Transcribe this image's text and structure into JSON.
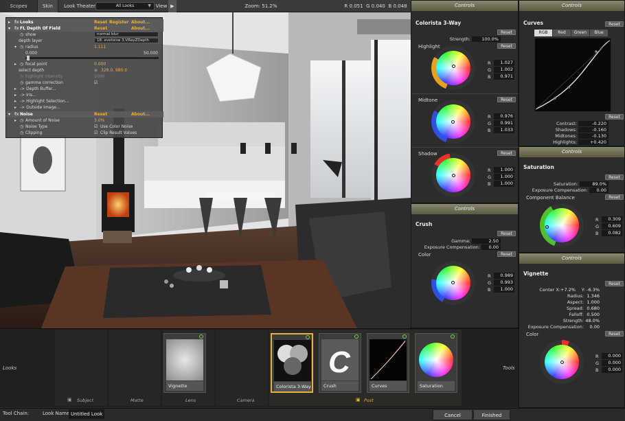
{
  "topbar": {
    "tab_scopes": "Scopes",
    "tab_skin": "Skin",
    "look_theater": "Look Theater",
    "looks_select": "All Looks",
    "view_label": "View",
    "zoom": "Zoom:  51.2%",
    "r": "R  0.051",
    "g": "G  0.040",
    "b": "B  0.048"
  },
  "looks_panel": {
    "looks": {
      "name": "Looks",
      "reset": "Reset",
      "register": "Register",
      "about": "About..."
    },
    "dof": {
      "name": "FL Depth Of Field",
      "reset": "Reset",
      "about": "About..."
    },
    "show_label": "show",
    "show_value": "normal blur",
    "depth_layer_label": "depth layer",
    "depth_layer_value": "18. evetoine 3.VRayZDepth",
    "radius_label": "radius",
    "radius_value": "1.111",
    "radius_min": "0.000",
    "radius_max": "50.000",
    "focal_label": "focal point",
    "focal_value": "0.000",
    "select_depth_label": "select depth",
    "select_depth_value": "328.0, 980.0",
    "highlight_intensity_label": "highlight intensity",
    "highlight_intensity_value": "1000",
    "gamma_label": "gamma correction",
    "depth_buffer": "-> Depth Buffer...",
    "iris": "-> Iris...",
    "highlight_selection": "-> Highlight Selection...",
    "outside_image": "-> Outside Image...",
    "noise": {
      "name": "Noise",
      "reset": "Reset",
      "about": "About..."
    },
    "amount_label": "Amount of Noise",
    "amount_value": "3.0%",
    "noise_type_label": "Noise Type",
    "use_color_noise": "Use Color Noise",
    "clipping_label": "Clipping",
    "clip_result": "Clip Result Values"
  },
  "colorista": {
    "header": "Controls",
    "title": "Colorista 3-Way",
    "reset": "Reset",
    "strength_label": "Strength:",
    "strength_value": "100.0%",
    "highlight": {
      "label": "Highlight",
      "reset": "Reset",
      "r": "1.027",
      "g": "1.002",
      "b": "0.971"
    },
    "midtone": {
      "label": "Midtone",
      "reset": "Reset",
      "r": "0.976",
      "g": "0.991",
      "b": "1.033"
    },
    "shadow": {
      "label": "Shadow",
      "reset": "Reset",
      "r": "1.000",
      "g": "1.000",
      "b": "1.000"
    }
  },
  "crush": {
    "header": "Controls",
    "title": "Crush",
    "reset": "Reset",
    "gamma_label": "Gamma:",
    "gamma_value": "2.50",
    "exposure_label": "Exposure Compensation:",
    "exposure_value": "0.00",
    "color": {
      "label": "Color",
      "reset": "Reset",
      "r": "0.989",
      "g": "0.993",
      "b": "1.000"
    }
  },
  "curves": {
    "header": "Controls",
    "title": "Curves",
    "reset": "Reset",
    "tabs": [
      "RGB",
      "Red",
      "Green",
      "Blue"
    ],
    "reset2": "Reset",
    "contrast_label": "Contrast:",
    "contrast_value": "-0.220",
    "shadows_label": "Shadows:",
    "shadows_value": "-0.160",
    "midtones_label": "Midtones:",
    "midtones_value": "-0.130",
    "highlights_label": "Highlights:",
    "highlights_value": "+0.420"
  },
  "saturation": {
    "header": "Controls",
    "title": "Saturation",
    "reset": "Reset",
    "sat_label": "Saturation:",
    "sat_value": "89.0%",
    "exposure_label": "Exposure Compensation:",
    "exposure_value": "0.00",
    "balance_label": "Component Balance",
    "balance_reset": "Reset",
    "r": "0.309",
    "g": "0.609",
    "b": "0.082"
  },
  "vignette": {
    "header": "Controls",
    "title": "Vignette",
    "reset": "Reset",
    "center_label": "Center X:",
    "center_x": "+7.2%",
    "y_label": "Y:",
    "center_y": "-6.3%",
    "radius_label": "Radius:",
    "radius_value": "1.346",
    "aspect_label": "Aspect:",
    "aspect_value": "1.000",
    "spread_label": "Spread:",
    "spread_value": "0.680",
    "falloff_label": "Falloff:",
    "falloff_value": "0.500",
    "strength_label": "Strength:",
    "strength_value": "48.0%",
    "exposure_label": "Exposure Compensation:",
    "exposure_value": "0.00",
    "color": {
      "label": "Color",
      "reset": "Reset",
      "r": "0.000",
      "g": "0.000",
      "b": "0.000"
    }
  },
  "bottom": {
    "looks_label": "Looks",
    "tools_label": "Tools",
    "slot_subject": "Subject",
    "slot_matte": "Matte",
    "slot_lens": "Lens",
    "slot_camera": "Camera",
    "slot_post": "Post",
    "thumbs": {
      "vignette": "Vignette",
      "colorista": "Colorista 3-Way",
      "crush": "Crush",
      "curves": "Curves",
      "saturation": "Saturation"
    }
  },
  "footer": {
    "toolchain_label": "Tool Chain:",
    "lookname_label": "Look Name:",
    "lookname_value": "Untitled Look",
    "cancel": "Cancel",
    "finished": "Finished"
  },
  "colors": {
    "accent": "#e8b040",
    "power_green": "#7ccf3f",
    "controls_bar": "#76735d"
  }
}
